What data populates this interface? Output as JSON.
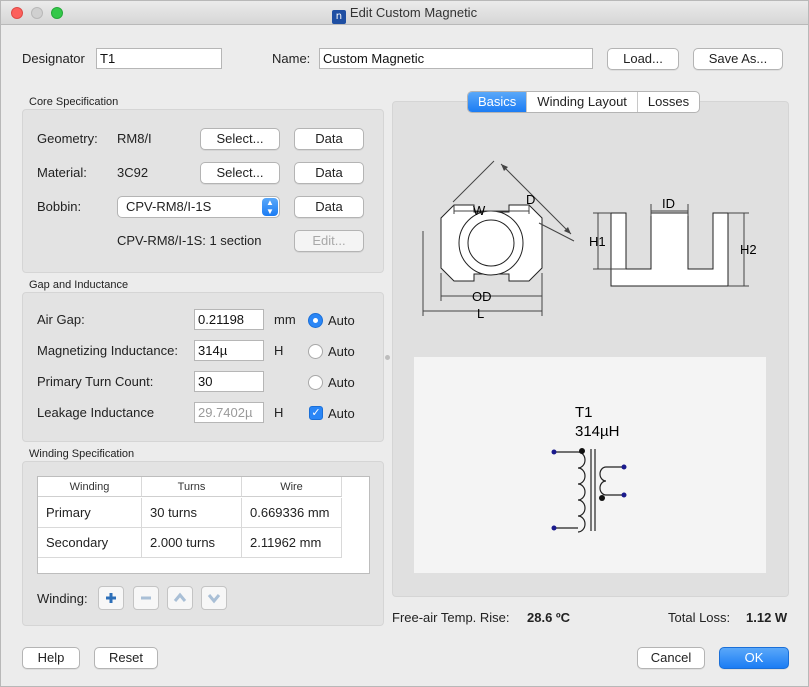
{
  "window": {
    "title": "Edit Custom Magnetic",
    "app_icon": "n"
  },
  "header": {
    "designator_label": "Designator",
    "designator_value": "T1",
    "name_label": "Name:",
    "name_value": "Custom Magnetic",
    "load_label": "Load...",
    "save_as_label": "Save As..."
  },
  "core": {
    "section_title": "Core Specification",
    "geometry_label": "Geometry:",
    "geometry_value": "RM8/I",
    "material_label": "Material:",
    "material_value": "3C92",
    "bobbin_label": "Bobbin:",
    "bobbin_value": "CPV-RM8/I-1S",
    "bobbin_info": "CPV-RM8/I-1S: 1 section",
    "select_label": "Select...",
    "data_label": "Data",
    "edit_label": "Edit..."
  },
  "gap": {
    "section_title": "Gap and Inductance",
    "air_gap_label": "Air Gap:",
    "air_gap_value": "0.21198",
    "air_gap_unit": "mm",
    "mag_ind_label": "Magnetizing Inductance:",
    "mag_ind_value": "314µ",
    "mag_ind_unit": "H",
    "turn_count_label": "Primary Turn Count:",
    "turn_count_value": "30",
    "leakage_label": "Leakage Inductance",
    "leakage_value": "29.7402µ",
    "leakage_unit": "H",
    "auto_label": "Auto",
    "air_gap_auto": true,
    "mag_ind_auto": false,
    "turn_count_auto": false,
    "leakage_auto": true
  },
  "winding": {
    "section_title": "Winding Specification",
    "columns": [
      "Winding",
      "Turns",
      "Wire"
    ],
    "rows": [
      {
        "winding": "Primary",
        "turns": "30 turns",
        "wire": "0.669336 mm"
      },
      {
        "winding": "Secondary",
        "turns": "2.000 turns",
        "wire": "2.11962 mm"
      }
    ],
    "controls_label": "Winding:",
    "controls_icons": [
      "plus-icon",
      "minus-icon",
      "chevron-up-icon",
      "chevron-down-icon"
    ]
  },
  "tabs": [
    {
      "label": "Basics",
      "active": true
    },
    {
      "label": "Winding Layout",
      "active": false
    },
    {
      "label": "Losses",
      "active": false
    }
  ],
  "diagram": {
    "labels": {
      "d": "D",
      "w": "W",
      "od": "OD",
      "l": "L",
      "id": "ID",
      "h1": "H1",
      "h2": "H2"
    }
  },
  "schematic": {
    "designator": "T1",
    "value": "314µH"
  },
  "summary": {
    "temp_rise_label": "Free-air Temp. Rise:",
    "temp_rise_value": "28.6 ºC",
    "total_loss_label": "Total Loss:",
    "total_loss_value": "1.12 W"
  },
  "footer": {
    "help_label": "Help",
    "reset_label": "Reset",
    "cancel_label": "Cancel",
    "ok_label": "OK"
  },
  "colors": {
    "accent": "#1b7cf4",
    "dot": "#1a1a8c"
  }
}
